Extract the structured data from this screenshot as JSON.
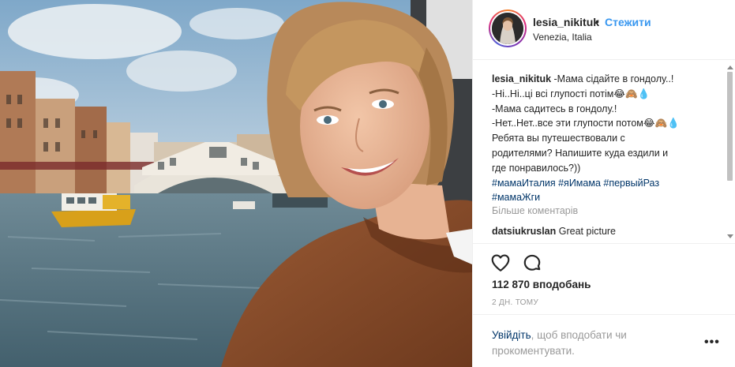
{
  "header": {
    "username": "lesia_nikituk",
    "separator": "•",
    "follow_label": "Стежити",
    "location": "Venezia, Italia"
  },
  "caption": {
    "username": "lesia_nikituk",
    "line1": " -Мама сідайте в гондолу..!",
    "line2": "-Ні..Ні..ці всі глупості потім😂🙈💧",
    "line3": "-Мама садитесь в гондолу.!",
    "line4": "-Нет..Нет..все эти глупости потом😂🙈💧",
    "line5": "Ребята вы путешествовали с",
    "line6": "родителями? Напишите куда ездили и",
    "line7": "где понравилось?))",
    "hashtags_line1": [
      "#мамаИталия",
      "#яИмама",
      "#первыйРаз"
    ],
    "hashtags_line2": [
      "#мамаЖги"
    ]
  },
  "comments": {
    "more_label": "Більше коментарів",
    "items": [
      {
        "username": "datsiukruslan",
        "text": " Great picture"
      }
    ]
  },
  "actions": {
    "like_icon": "heart-outline-icon",
    "comment_icon": "speech-bubble-icon"
  },
  "likes": "112 870 вподобань",
  "timestamp": "2 ДН. ТОМУ",
  "login_prompt": {
    "link": "Увійдіть",
    "text": ", щоб вподобати чи прокоментувати."
  },
  "more_options": "•••",
  "colors": {
    "link_blue": "#3897f0",
    "hashtag": "#003569",
    "muted": "#999999",
    "text": "#262626"
  }
}
